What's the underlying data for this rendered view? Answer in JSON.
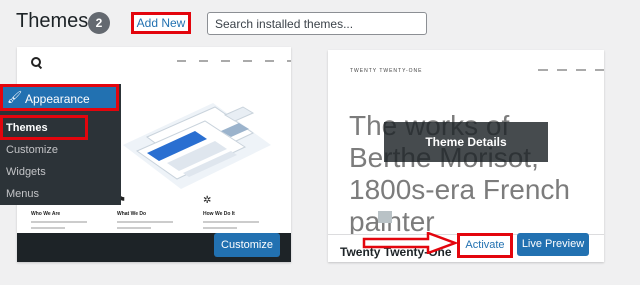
{
  "header": {
    "title": "Themes",
    "count": "2",
    "add_new_label": "Add New",
    "search_placeholder": "Search installed themes..."
  },
  "admin_menu": {
    "appearance_label": "Appearance",
    "appearance_icon": "paintbrush-icon",
    "items": [
      {
        "label": "Themes",
        "current": true
      },
      {
        "label": "Customize",
        "current": false
      },
      {
        "label": "Widgets",
        "current": false
      },
      {
        "label": "Menus",
        "current": false
      }
    ]
  },
  "theme1": {
    "features": [
      "Who We Are",
      "What We Do",
      "How We Do It"
    ],
    "customize_label": "Customize"
  },
  "theme2": {
    "site_title": "TWENTY TWENTY-ONE",
    "headline": "The works of Berthe Morisot, 1800s-era French painter",
    "overlay_label": "Theme Details",
    "name": "Twenty Twenty-One",
    "activate_label": "Activate",
    "preview_label": "Live Preview"
  },
  "colors": {
    "accent": "#2271b1",
    "highlight": "#e3050d",
    "menu_bg": "#2c3338",
    "bar_dark": "#1d2327",
    "page_bg": "#f0f0f1"
  }
}
